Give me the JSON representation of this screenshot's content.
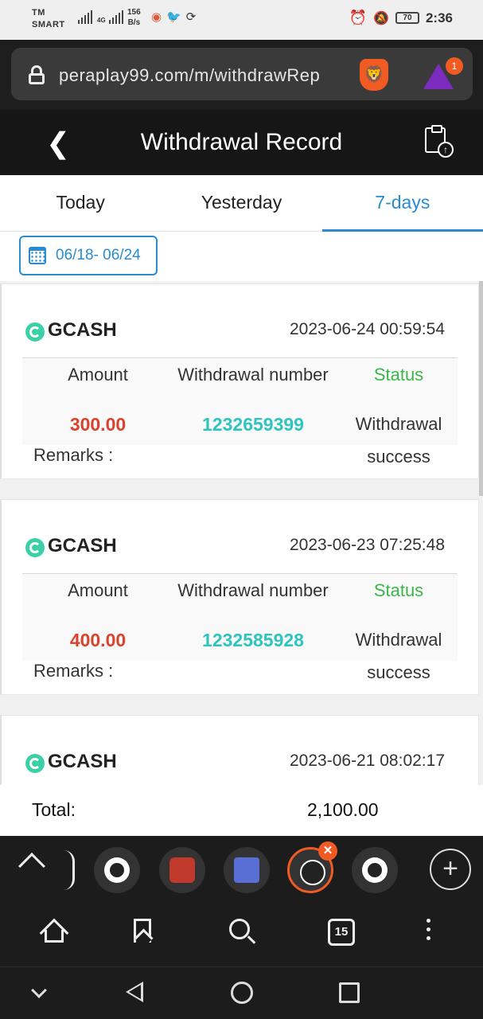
{
  "status_bar": {
    "carrier_line1": "TM",
    "carrier_line2": "SMART",
    "signal_label": "4G",
    "net_speed_value": "156",
    "net_speed_unit": "B/s",
    "battery": "70",
    "time": "2:36"
  },
  "browser": {
    "url": "peraplay99.com/m/withdrawRep",
    "rewards_badge": "1",
    "tab_count": "15"
  },
  "header": {
    "title": "Withdrawal Record"
  },
  "tabs": [
    {
      "label": "Today",
      "active": false
    },
    {
      "label": "Yesterday",
      "active": false
    },
    {
      "label": "7-days",
      "active": true
    }
  ],
  "date_filter": {
    "range": "06/18- 06/24"
  },
  "columns": {
    "amount": "Amount",
    "number": "Withdrawal number",
    "status": "Status"
  },
  "records": [
    {
      "method": "GCASH",
      "datetime": "2023-06-24 00:59:54",
      "amount": "300.00",
      "number": "1232659399",
      "status_line1": "Withdrawal",
      "status_line2": "success",
      "remarks_label": "Remarks :"
    },
    {
      "method": "GCASH",
      "datetime": "2023-06-23 07:25:48",
      "amount": "400.00",
      "number": "1232585928",
      "status_line1": "Withdrawal",
      "status_line2": "success",
      "remarks_label": "Remarks :"
    },
    {
      "method": "GCASH",
      "datetime": "2023-06-21 08:02:17"
    }
  ],
  "total": {
    "label": "Total:",
    "value": "2,100.00"
  },
  "colors": {
    "accent_blue": "#2a8bd0",
    "amount_red": "#d9432f",
    "number_teal": "#2fc4c0",
    "status_green": "#3cb54a",
    "brave_orange": "#f15a22"
  }
}
